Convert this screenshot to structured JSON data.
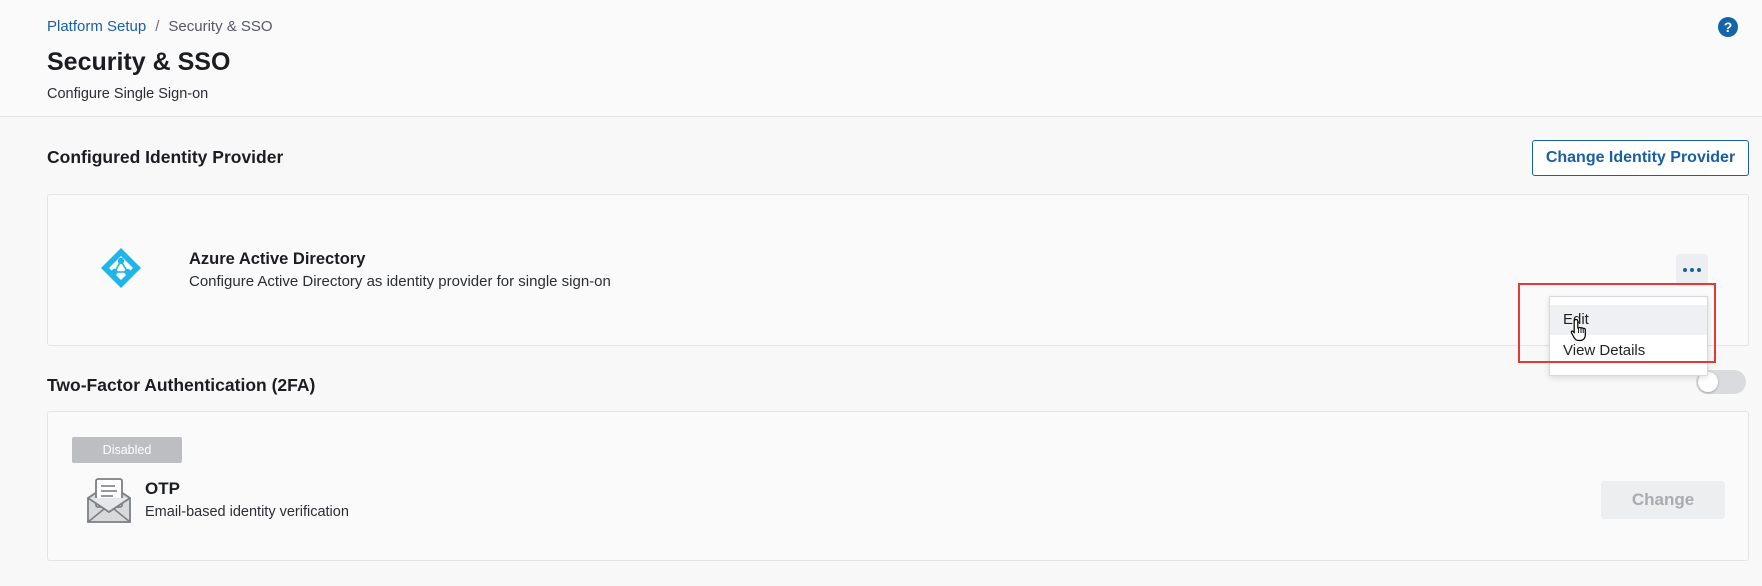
{
  "breadcrumb": {
    "parent": "Platform Setup",
    "separator": "/",
    "current": "Security & SSO"
  },
  "header": {
    "title": "Security & SSO",
    "subtitle": "Configure Single Sign-on",
    "help_glyph": "?"
  },
  "identity_provider": {
    "section_title": "Configured Identity Provider",
    "change_button": "Change Identity Provider",
    "provider_name": "Azure Active Directory",
    "provider_description": "Configure Active Directory as identity provider for single sign-on",
    "menu": {
      "items": [
        "Edit",
        "View Details"
      ]
    }
  },
  "two_factor": {
    "section_title": "Two-Factor Authentication (2FA)",
    "status_badge": "Disabled",
    "method_name": "OTP",
    "method_description": "Email-based identity verification",
    "change_button": "Change",
    "enabled": false
  },
  "colors": {
    "accent": "#1a5fa6",
    "highlight": "#e53935",
    "azure": "#1fb5e8"
  },
  "icons": [
    "help-icon",
    "azure-ad-icon",
    "more-icon",
    "pointer-cursor-icon",
    "email-otp-icon"
  ]
}
